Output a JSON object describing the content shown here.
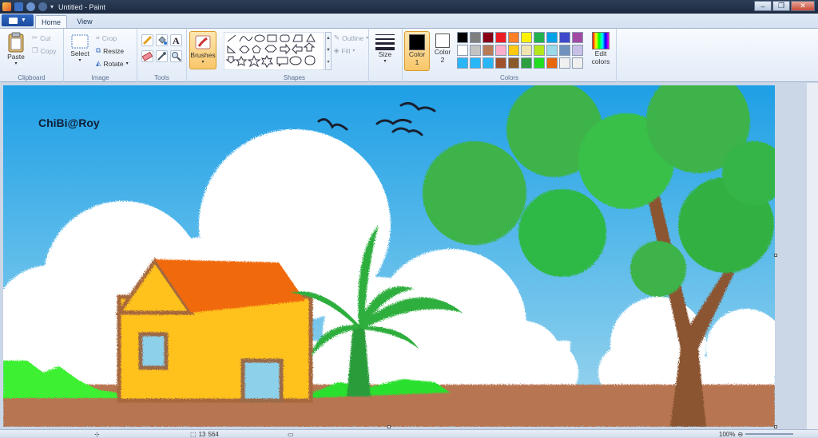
{
  "titlebar": {
    "title": "Untitled - Paint",
    "buttons": {
      "minimize": "–",
      "maximize": "❐",
      "close": "✕"
    }
  },
  "menu": {
    "tabs": [
      {
        "label": "Home"
      },
      {
        "label": "View"
      }
    ]
  },
  "ribbon": {
    "clipboard": {
      "label": "Clipboard",
      "paste": "Paste",
      "cut": "Cut",
      "copy": "Copy"
    },
    "image": {
      "label": "Image",
      "select": "Select",
      "crop": "Crop",
      "resize": "Resize",
      "rotate": "Rotate"
    },
    "tools": {
      "label": "Tools"
    },
    "brushes": {
      "label": "Brushes"
    },
    "shapes": {
      "label": "Shapes",
      "outline": "Outline",
      "fill": "Fill"
    },
    "size": {
      "label": "Size"
    },
    "colors": {
      "label": "Colors",
      "color1_a": "Color",
      "color1_b": "1",
      "color2_a": "Color",
      "color2_b": "2",
      "edit_a": "Edit",
      "edit_b": "colors",
      "color1_value": "#000000",
      "color2_value": "#ffffff",
      "palette": [
        "#000000",
        "#7f7f7f",
        "#880015",
        "#ed1c24",
        "#ff7f27",
        "#fff200",
        "#22b14c",
        "#00a2e8",
        "#3f48cc",
        "#a349a4",
        "#ffffff",
        "#c3c3c3",
        "#b97a57",
        "#ffaec9",
        "#ffc90e",
        "#efe4b0",
        "#b5e61d",
        "#99d9ea",
        "#7092be",
        "#c8bfe7",
        "#29b6f6",
        "#29b6f6",
        "#29b6f6",
        "#a0522d",
        "#8b5a2b",
        "#2e9e3e",
        "#22dd22",
        "#e8660e",
        "#f0f0f0",
        "#f0f0f0"
      ]
    }
  },
  "canvas": {
    "signature": "ChiBi@Roy"
  },
  "status": {
    "position": "13",
    "size": "564",
    "zoom": "100%"
  }
}
